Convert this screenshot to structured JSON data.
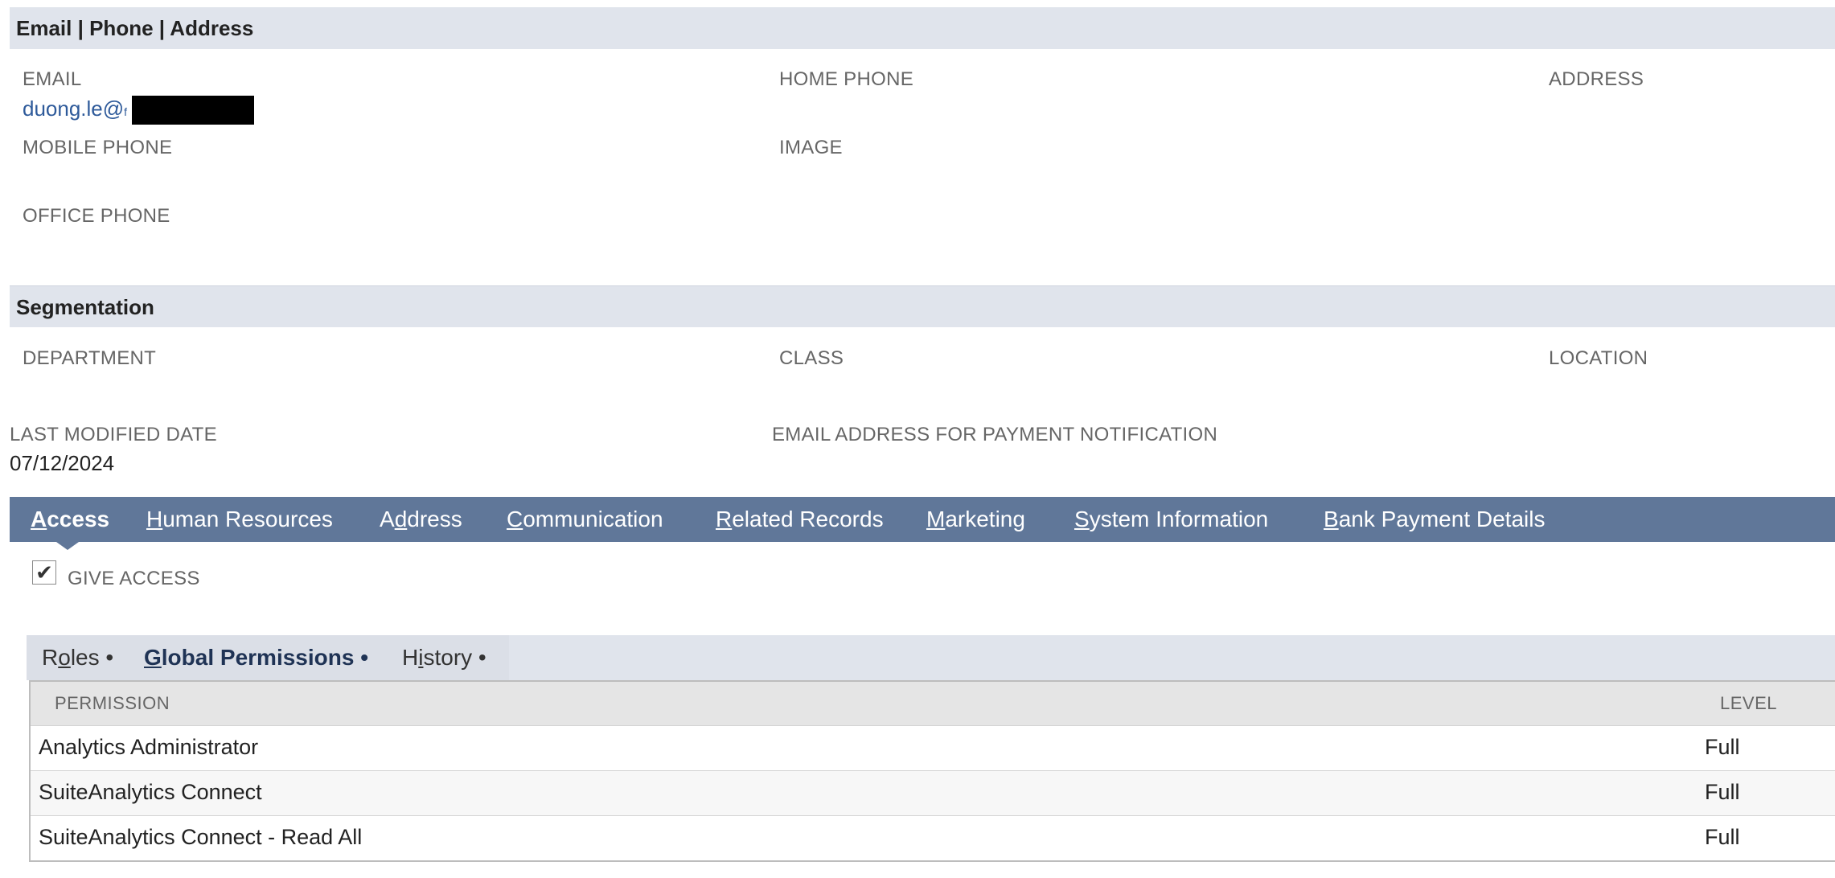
{
  "contact_section": {
    "title": "Email | Phone | Address",
    "email_label": "EMAIL",
    "email_value": "duong.le@",
    "email_trailing": "f",
    "home_phone_label": "HOME PHONE",
    "address_label": "ADDRESS",
    "mobile_phone_label": "MOBILE PHONE",
    "image_label": "IMAGE",
    "office_phone_label": "OFFICE PHONE"
  },
  "segmentation_section": {
    "title": "Segmentation",
    "department_label": "DEPARTMENT",
    "class_label": "CLASS",
    "location_label": "LOCATION"
  },
  "meta": {
    "last_modified_label": "LAST MODIFIED DATE",
    "last_modified_value": "07/12/2024",
    "payment_email_label": "EMAIL ADDRESS FOR PAYMENT NOTIFICATION"
  },
  "tabs": [
    {
      "key": "A",
      "rest": "ccess",
      "pre": "",
      "active": true
    },
    {
      "key": "H",
      "rest": "uman Resources",
      "pre": "",
      "active": false
    },
    {
      "key": "d",
      "rest": "dress",
      "pre": "A",
      "active": false
    },
    {
      "key": "C",
      "rest": "ommunication",
      "pre": "",
      "active": false
    },
    {
      "key": "R",
      "rest": "elated Records",
      "pre": "",
      "active": false
    },
    {
      "key": "M",
      "rest": "arketing",
      "pre": "",
      "active": false
    },
    {
      "key": "S",
      "rest": "ystem Information",
      "pre": "",
      "active": false
    },
    {
      "key": "B",
      "rest": "ank Payment Details",
      "pre": "",
      "active": false
    }
  ],
  "access": {
    "give_access_label": "GIVE ACCESS",
    "give_access_checked": true,
    "checkmark_glyph": "✔"
  },
  "subtabs": [
    {
      "pre": "R",
      "key": "o",
      "rest": "les •",
      "active": false
    },
    {
      "pre": "",
      "key": "G",
      "rest": "lobal Permissions •",
      "active": true
    },
    {
      "pre": "H",
      "key": "i",
      "rest": "story •",
      "active": false
    }
  ],
  "permissions_table": {
    "columns": [
      "PERMISSION",
      "LEVEL"
    ],
    "rows": [
      {
        "permission": "Analytics Administrator",
        "level": "Full"
      },
      {
        "permission": "SuiteAnalytics Connect",
        "level": "Full"
      },
      {
        "permission": "SuiteAnalytics Connect - Read All",
        "level": "Full"
      }
    ]
  }
}
